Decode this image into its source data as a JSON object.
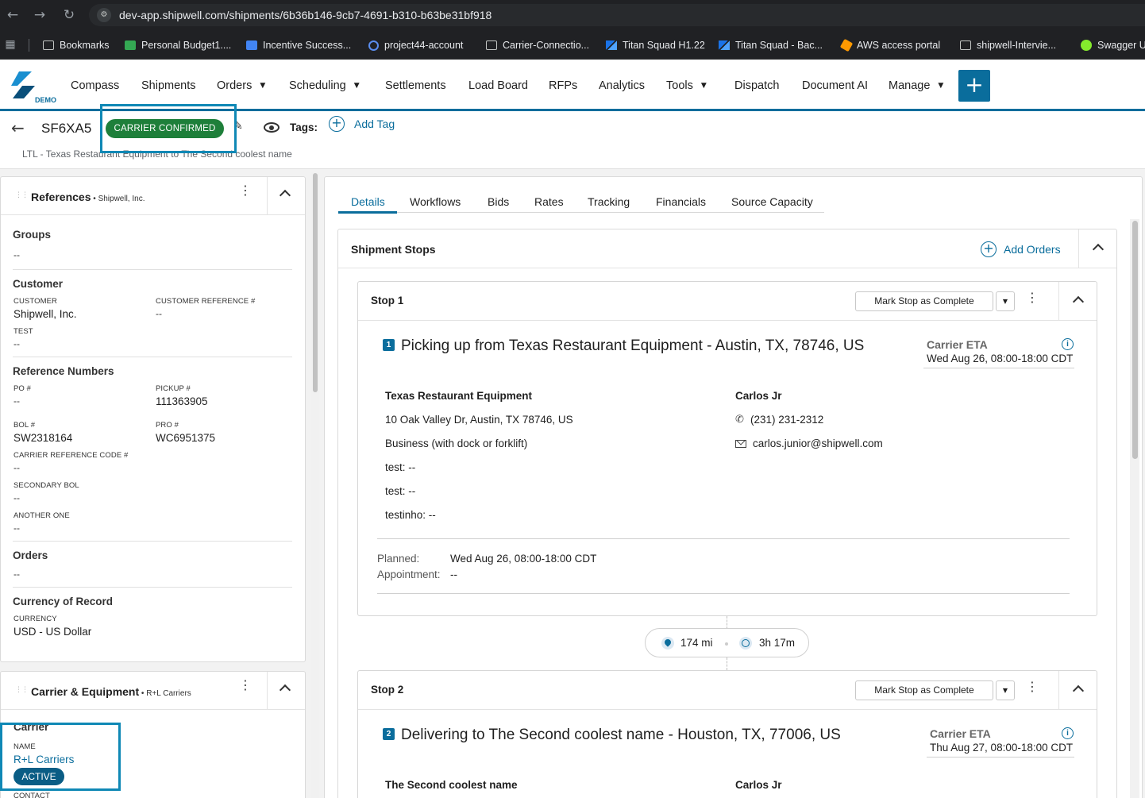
{
  "browser": {
    "url": "dev-app.shipwell.com/shipments/6b36b146-9cb7-4691-b310-b63be31bf918",
    "bookmarks": [
      {
        "label": "Bookmarks",
        "icon": "folder-icon"
      },
      {
        "label": "Personal Budget1....",
        "icon": "sheet-icon"
      },
      {
        "label": "Incentive Success...",
        "icon": "doc-icon"
      },
      {
        "label": "project44-account",
        "icon": "gear-icon"
      },
      {
        "label": "Carrier-Connectio...",
        "icon": "folder-icon"
      },
      {
        "label": "Titan Squad H1.22",
        "icon": "shipwell-icon"
      },
      {
        "label": "Titan Squad - Bac...",
        "icon": "shipwell-icon"
      },
      {
        "label": "AWS access portal",
        "icon": "aws-icon"
      },
      {
        "label": "shipwell-Intervie...",
        "icon": "folder-icon"
      },
      {
        "label": "Swagger U",
        "icon": "swagger-icon"
      }
    ]
  },
  "nav": {
    "logo_badge": "DEMO",
    "items": [
      {
        "label": "Compass",
        "caret": false
      },
      {
        "label": "Shipments",
        "caret": false
      },
      {
        "label": "Orders",
        "caret": true
      },
      {
        "label": "Scheduling",
        "caret": true
      },
      {
        "label": "Settlements",
        "caret": false
      },
      {
        "label": "Load Board",
        "caret": false
      },
      {
        "label": "RFPs",
        "caret": false
      },
      {
        "label": "Analytics",
        "caret": false
      },
      {
        "label": "Tools",
        "caret": true
      },
      {
        "label": "Dispatch",
        "caret": false
      },
      {
        "label": "Document AI",
        "caret": false
      },
      {
        "label": "Manage",
        "caret": true
      }
    ],
    "plus": "+"
  },
  "shipment": {
    "id": "SF6XA5",
    "status": "CARRIER CONFIRMED",
    "tags_label": "Tags:",
    "add_tag": "Add Tag",
    "route": "LTL - Texas Restaurant Equipment to The Second coolest name"
  },
  "references": {
    "title": "References",
    "company": "Shipwell, Inc.",
    "groups_title": "Groups",
    "groups_value": "--",
    "customer_title": "Customer",
    "customer_label": "CUSTOMER",
    "customer_value": "Shipwell, Inc.",
    "customer_ref_label": "CUSTOMER REFERENCE #",
    "customer_ref_value": "--",
    "test_label": "TEST",
    "test_value": "--",
    "refnums_title": "Reference Numbers",
    "po_label": "PO #",
    "po_value": "--",
    "pickup_label": "PICKUP #",
    "pickup_value": "111363905",
    "bol_label": "BOL #",
    "bol_value": "SW2318164",
    "pro_label": "PRO #",
    "pro_value": "WC6951375",
    "carrier_ref_label": "CARRIER REFERENCE CODE #",
    "carrier_ref_value": "--",
    "secondary_bol_label": "SECONDARY BOL",
    "secondary_bol_value": "--",
    "another_label": "ANOTHER ONE",
    "another_value": "--",
    "orders_title": "Orders",
    "orders_value": "--",
    "currency_title": "Currency of Record",
    "currency_label": "CURRENCY",
    "currency_value": "USD - US Dollar"
  },
  "carrier_equipment": {
    "title": "Carrier & Equipment",
    "company": "R+L Carriers",
    "carrier_title": "Carrier",
    "name_label": "NAME",
    "name_value": "R+L Carriers",
    "status": "ACTIVE",
    "contact_label": "CONTACT"
  },
  "tabs": [
    "Details",
    "Workflows",
    "Bids",
    "Rates",
    "Tracking",
    "Financials",
    "Source Capacity"
  ],
  "stops_panel": {
    "title": "Shipment Stops",
    "add_orders": "Add Orders",
    "mark_complete": "Mark Stop as Complete",
    "eta_label": "Carrier ETA",
    "stops": [
      {
        "title": "Stop 1",
        "number": "1",
        "heading": "Picking up from Texas Restaurant Equipment - Austin, TX, 78746, US",
        "eta": "Wed Aug 26, 08:00-18:00 CDT",
        "company": "Texas Restaurant Equipment",
        "address": "10 Oak Valley Dr, Austin, TX 78746, US",
        "location_type": "Business (with dock or forklift)",
        "custom1": "test: --",
        "custom2": "test: --",
        "custom3": "testinho: --",
        "contact_name": "Carlos Jr",
        "phone": "(231) 231-2312",
        "email": "carlos.junior@shipwell.com",
        "planned_label": "Planned:",
        "planned_value": "Wed Aug 26, 08:00-18:00 CDT",
        "appointment_label": "Appointment:",
        "appointment_value": "--"
      },
      {
        "title": "Stop 2",
        "number": "2",
        "heading": "Delivering to The Second coolest name - Houston, TX, 77006, US",
        "eta": "Thu Aug 27, 08:00-18:00 CDT",
        "company": "The Second coolest name",
        "contact_name": "Carlos Jr"
      }
    ],
    "distance": "174 mi",
    "duration": "3h 17m"
  },
  "colors": {
    "accent": "#0a6d9c",
    "status_green": "#1e7f3a",
    "highlight_box": "#0f88b5"
  }
}
